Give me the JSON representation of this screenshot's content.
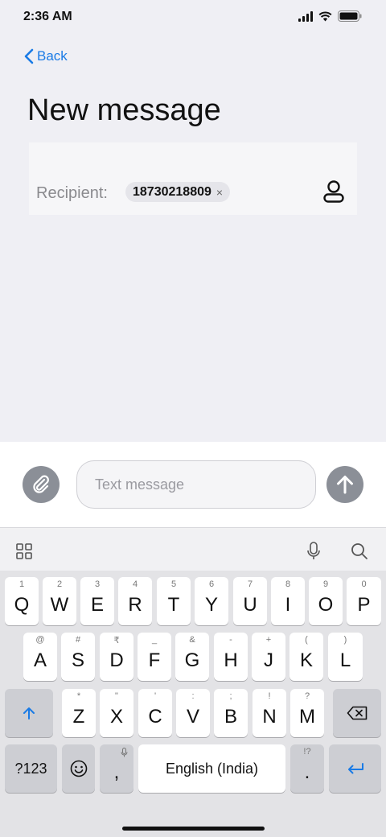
{
  "status_bar": {
    "time": "2:36 AM"
  },
  "nav": {
    "back_label": "Back"
  },
  "page": {
    "title": "New message"
  },
  "recipient": {
    "label": "Recipient:",
    "chip_number": "18730218809",
    "chip_remove": "×"
  },
  "compose": {
    "placeholder": "Text message"
  },
  "keyboard": {
    "row1": [
      {
        "hint": "1",
        "key": "Q"
      },
      {
        "hint": "2",
        "key": "W"
      },
      {
        "hint": "3",
        "key": "E"
      },
      {
        "hint": "4",
        "key": "R"
      },
      {
        "hint": "5",
        "key": "T"
      },
      {
        "hint": "6",
        "key": "Y"
      },
      {
        "hint": "7",
        "key": "U"
      },
      {
        "hint": "8",
        "key": "I"
      },
      {
        "hint": "9",
        "key": "O"
      },
      {
        "hint": "0",
        "key": "P"
      }
    ],
    "row2": [
      {
        "hint": "@",
        "key": "A"
      },
      {
        "hint": "#",
        "key": "S"
      },
      {
        "hint": "₹",
        "key": "D"
      },
      {
        "hint": "_",
        "key": "F"
      },
      {
        "hint": "&",
        "key": "G"
      },
      {
        "hint": "-",
        "key": "H"
      },
      {
        "hint": "+",
        "key": "J"
      },
      {
        "hint": "(",
        "key": "K"
      },
      {
        "hint": ")",
        "key": "L"
      }
    ],
    "row3": [
      {
        "hint": "*",
        "key": "Z"
      },
      {
        "hint": "\"",
        "key": "X"
      },
      {
        "hint": "'",
        "key": "C"
      },
      {
        "hint": ":",
        "key": "V"
      },
      {
        "hint": ";",
        "key": "B"
      },
      {
        "hint": "!",
        "key": "N"
      },
      {
        "hint": "?",
        "key": "M"
      }
    ],
    "symbols_key": "?123",
    "comma_key": ",",
    "space_label": "English (India)",
    "period_key": ".",
    "period_hint": "!?"
  },
  "colors": {
    "accent": "#1a7be6",
    "button_gray": "#8b8f97",
    "background": "#efeff4"
  },
  "icons": {
    "attach": "paperclip-icon",
    "send": "arrow-up-icon",
    "contact": "person-icon",
    "grid": "grid-icon",
    "mic": "microphone-icon",
    "search": "search-icon",
    "shift": "shift-icon",
    "backspace": "backspace-icon",
    "emoji": "emoji-icon",
    "enter": "enter-icon"
  }
}
